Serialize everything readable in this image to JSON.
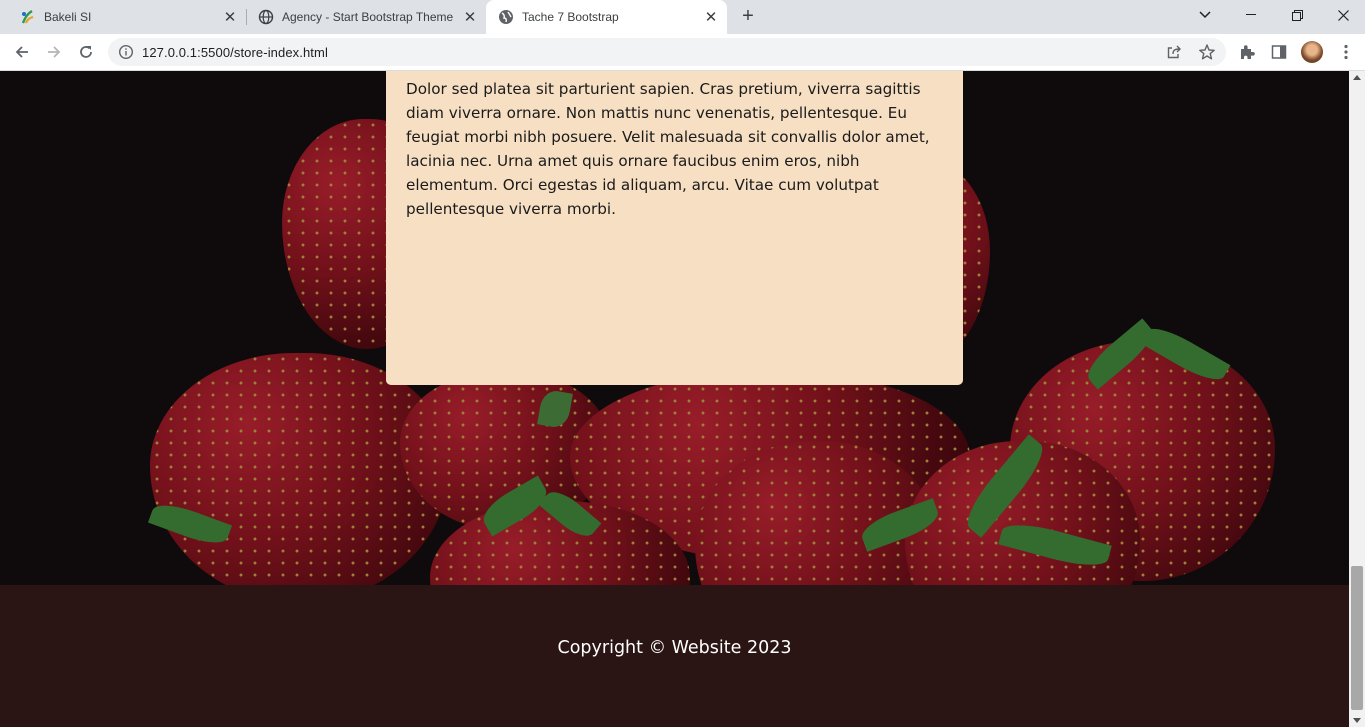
{
  "tabs": [
    {
      "title": "Bakeli SI",
      "icon": "bakeli-logo-icon"
    },
    {
      "title": "Agency - Start Bootstrap Theme",
      "icon": "globe-icon"
    },
    {
      "title": "Tache 7 Bootstrap",
      "icon": "globe-icon",
      "active": true
    }
  ],
  "address": {
    "url": "127.0.0.1:5500/store-index.html"
  },
  "card": {
    "text": "Dolor sed platea sit parturient sapien. Cras pretium, viverra sagittis diam viverra ornare. Non mattis nunc venenatis, pellentesque. Eu feugiat morbi nibh posuere. Velit malesuada sit convallis dolor amet, lacinia nec. Urna amet quis ornare faucibus enim eros, nibh elementum. Orci egestas id aliquam, arcu. Vitae cum volutpat pellentesque viverra morbi."
  },
  "footer": {
    "copyright": "Copyright © Website 2023"
  },
  "colors": {
    "card_bg": "#f6dfc2",
    "footer_bg": "#2b1414",
    "hero_bg": "#110c0e"
  }
}
